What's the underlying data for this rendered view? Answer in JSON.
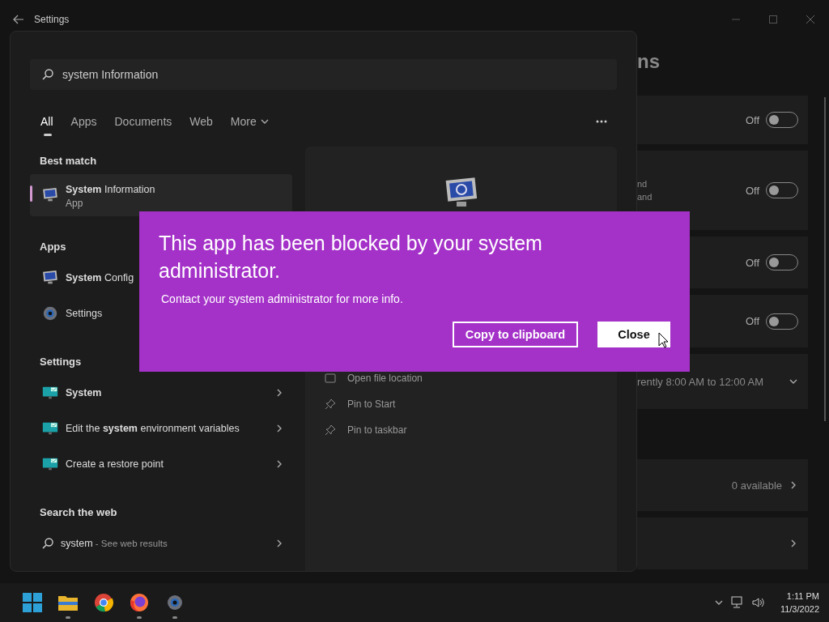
{
  "settings_window": {
    "title": "Settings",
    "heading_fragment": "ns",
    "cards": [
      {
        "kind": "toggle",
        "status": "Off",
        "on": false
      },
      {
        "kind": "toggle",
        "lines": [
          "nd",
          "and"
        ],
        "status": "Off",
        "on": false
      },
      {
        "kind": "toggle",
        "status": "Off",
        "on": false
      },
      {
        "kind": "toggle",
        "status": "Off",
        "on": false
      },
      {
        "kind": "expander",
        "lines": [
          "rently 8:00 AM to 12:00 AM"
        ]
      },
      {
        "kind": "link",
        "lines": [
          "0 available"
        ]
      },
      {
        "kind": "link"
      }
    ]
  },
  "search_panel": {
    "query": "system Information",
    "tabs": [
      {
        "label": "All",
        "selected": true,
        "has_menu": false
      },
      {
        "label": "Apps",
        "selected": false,
        "has_menu": false
      },
      {
        "label": "Documents",
        "selected": false,
        "has_menu": false
      },
      {
        "label": "Web",
        "selected": false,
        "has_menu": false
      },
      {
        "label": "More",
        "selected": false,
        "has_menu": true
      }
    ],
    "sections": [
      {
        "title": "Best match",
        "items": [
          {
            "kind": "legacy-app",
            "title": "**System** Information",
            "subtitle": "App",
            "selected": true,
            "has_chevron": false
          }
        ]
      },
      {
        "title": "Apps",
        "items": [
          {
            "kind": "legacy-app",
            "title": "**System** Config",
            "selected": false,
            "has_chevron": false
          },
          {
            "kind": "settings-app",
            "title": "Settings",
            "selected": false,
            "has_chevron": false
          }
        ]
      },
      {
        "title": "Settings",
        "items": [
          {
            "kind": "settings-page",
            "title": "**System**",
            "selected": false,
            "has_chevron": true
          },
          {
            "kind": "settings-page",
            "title": "Edit the **system** environment variables",
            "selected": false,
            "has_chevron": true
          },
          {
            "kind": "settings-page",
            "title": "Create a restore point",
            "selected": false,
            "has_chevron": true
          }
        ]
      },
      {
        "title": "Search the web",
        "items": [
          {
            "kind": "web-search",
            "title": "system",
            "hint": "- See web results",
            "selected": false,
            "has_chevron": true
          }
        ]
      }
    ],
    "preview_actions": [
      {
        "kind": "folder",
        "label": "Open file location"
      },
      {
        "kind": "pin",
        "label": "Pin to Start"
      },
      {
        "kind": "pin",
        "label": "Pin to taskbar"
      }
    ]
  },
  "dialog": {
    "title": "This app has been blocked by your system administrator.",
    "message": "Contact your system administrator for more info.",
    "buttons": [
      {
        "kind": "outline",
        "label": "Copy to clipboard"
      },
      {
        "kind": "primary",
        "label": "Close"
      }
    ]
  },
  "taskbar": {
    "apps": [
      {
        "kind": "start",
        "running": false
      },
      {
        "kind": "files",
        "running": true
      },
      {
        "kind": "chrome",
        "running": false
      },
      {
        "kind": "firefox",
        "running": true
      },
      {
        "kind": "settings",
        "running": true
      }
    ],
    "time": "1:11 PM",
    "date": "11/3/2022"
  }
}
